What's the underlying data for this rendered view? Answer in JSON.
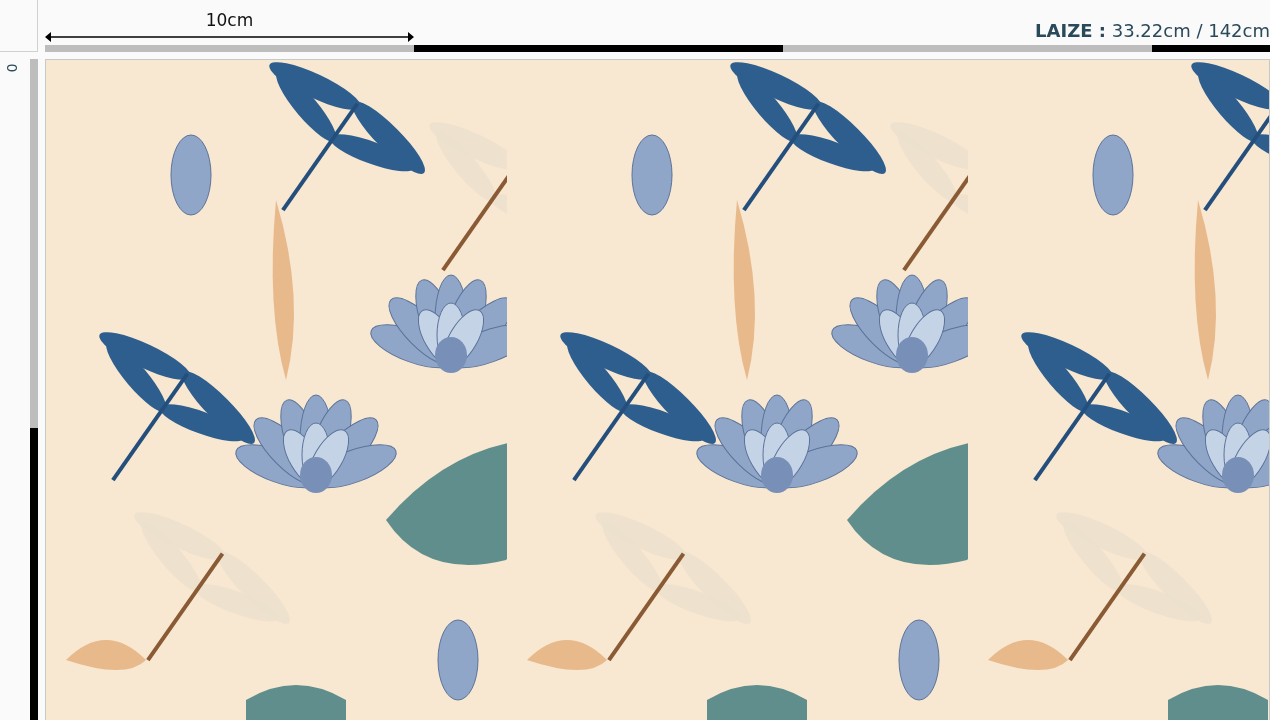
{
  "top_ruler": {
    "scale_label": "10cm",
    "width_label": "LAIZE :",
    "width_value": "33.22cm / 142cm"
  },
  "left_ruler": {
    "origin_label": "0"
  }
}
